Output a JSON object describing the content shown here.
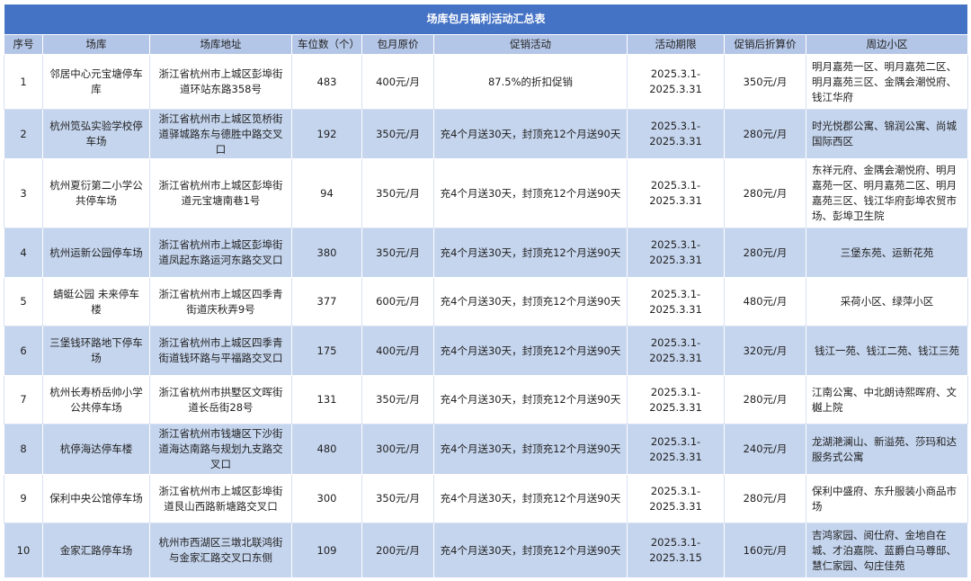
{
  "title": "场库包月福利活动汇总表",
  "headers": [
    "序号",
    "场库",
    "场库地址",
    "车位数（个）",
    "包月原价",
    "促销活动",
    "活动期限",
    "促销后折算价",
    "周边小区"
  ],
  "rows": [
    {
      "no": "1",
      "name": "邻居中心元宝塘停车库",
      "address": "浙江省杭州市上城区彭埠街道环站东路358号",
      "spaces": "483",
      "price": "400元/月",
      "promo": "87.5%的折扣促销",
      "period": "2025.3.1-2025.3.31",
      "discount": "350元/月",
      "nearby": "明月嘉苑一区、明月嘉苑二区、明月嘉苑三区、金隅会潮悦府、钱江华府"
    },
    {
      "no": "2",
      "name": "杭州笕弘实验学校停车场",
      "address": "浙江省杭州市上城区笕桥街道驿城路东与德胜中路交叉口",
      "spaces": "192",
      "price": "350元/月",
      "promo": "充4个月送30天，封顶充12个月送90天",
      "period": "2025.3.1-2025.3.31",
      "discount": "280元/月",
      "nearby": "时光悦郡公寓、锦润公寓、尚城国际西区"
    },
    {
      "no": "3",
      "name": "杭州夏衍第二小学公共停车场",
      "address": "浙江省杭州市上城区彭埠街道元宝塘南巷1号",
      "spaces": "94",
      "price": "350元/月",
      "promo": "充4个月送30天，封顶充12个月送90天",
      "period": "2025.3.1-2025.3.31",
      "discount": "280元/月",
      "nearby": "东祥元府、金隅会潮悦府、明月嘉苑一区、明月嘉苑二区、明月嘉苑三区、钱江华府彭埠农贸市场、彭埠卫生院"
    },
    {
      "no": "4",
      "name": "杭州运新公园停车场",
      "address": "浙江省杭州市上城区彭埠街道凤起东路运河东路交叉口",
      "spaces": "380",
      "price": "350元/月",
      "promo": "充4个月送30天，封顶充12个月送90天",
      "period": "2025.3.1-2025.3.31",
      "discount": "280元/月",
      "nearby": "三堡东苑、运新花苑"
    },
    {
      "no": "5",
      "name": "蜻蜓公园 未来停车楼",
      "address": "浙江省杭州市上城区四季青街道庆秋弄9号",
      "spaces": "377",
      "price": "600元/月",
      "promo": "充4个月送30天，封顶充12个月送90天",
      "period": "2025.3.1-2025.3.31",
      "discount": "480元/月",
      "nearby": "采荷小区、绿萍小区"
    },
    {
      "no": "6",
      "name": "三堡钱环路地下停车场",
      "address": "浙江省杭州市上城区四季青街道钱环路与平福路交叉口",
      "spaces": "175",
      "price": "400元/月",
      "promo": "充4个月送30天，封顶充12个月送90天",
      "period": "2025.3.1-2025.3.31",
      "discount": "320元/月",
      "nearby": "钱江一苑、钱江二苑、钱江三苑"
    },
    {
      "no": "7",
      "name": "杭州长寿桥岳帅小学公共停车场",
      "address": "浙江省杭州市拱墅区文晖街道长岳街28号",
      "spaces": "131",
      "price": "350元/月",
      "promo": "充4个月送30天，封顶充12个月送90天",
      "period": "2025.3.1-2025.3.31",
      "discount": "280元/月",
      "nearby": "江南公寓、中北朗诗熙晖府、文樾上院"
    },
    {
      "no": "8",
      "name": "杭停海达停车楼",
      "address": "浙江省杭州市钱塘区下沙街道海达南路与规划九支路交叉口",
      "spaces": "480",
      "price": "300元/月",
      "promo": "充4个月送30天，封顶充12个月送90天",
      "period": "2025.3.1-2025.3.31",
      "discount": "240元/月",
      "nearby": "龙湖滟澜山、新溢苑、莎玛和达服务式公寓"
    },
    {
      "no": "9",
      "name": "保利中央公馆停车场",
      "address": "浙江省杭州市上城区彭埠街道艮山西路新塘路交叉口",
      "spaces": "300",
      "price": "350元/月",
      "promo": "充4个月送30天，封顶充12个月送90天",
      "period": "2025.3.1-2025.3.31",
      "discount": "280元/月",
      "nearby": "保利中盛府、东升服装小商品市场"
    },
    {
      "no": "10",
      "name": "金家汇路停车场",
      "address": "杭州市西湖区三墩北联鸿街与金家汇路交叉口东侧",
      "spaces": "109",
      "price": "200元/月",
      "promo": "充4个月送30天，封顶充12个月送90天",
      "period": "2025.3.1-2025.3.15",
      "discount": "160元/月",
      "nearby": "吉鸿家园、阅仕府、金地自在城、才泊嘉院、蓝爵白马尊邸、慧仁家园、勾庄佳苑"
    }
  ]
}
